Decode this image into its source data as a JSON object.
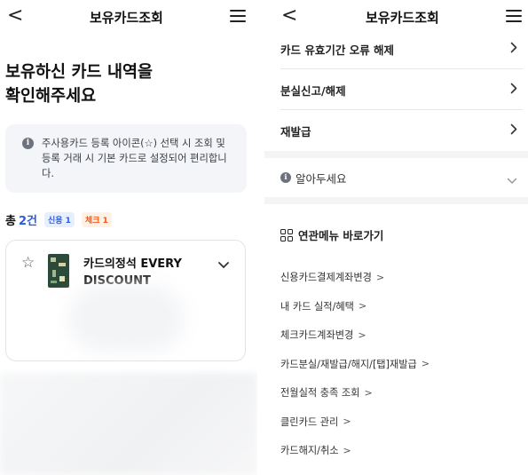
{
  "left": {
    "header": {
      "back": "<",
      "title": "보유카드조회"
    },
    "heading_line1": "보유하신 카드 내역을",
    "heading_line2": "확인해주세요",
    "notice": {
      "icon": "i",
      "text": "주사용카드 등록 아이콘(☆) 선택 시 조회 및 등록 거래 시 기본 카드로 설정되어 편리합니다."
    },
    "summary": {
      "total_label": "총",
      "total_count": "2건",
      "badge_credit": "신용 1",
      "badge_check": "체크 1"
    },
    "card": {
      "star": "☆",
      "name": "카드의정석 EVERY DISCOUNT"
    }
  },
  "right": {
    "header": {
      "back": "<",
      "title": "보유카드조회"
    },
    "rows": [
      {
        "label": "카드 유효기간 오류 해제",
        "arrow": ">"
      },
      {
        "label": "분실신고/해제",
        "arrow": ">"
      },
      {
        "label": "재발급",
        "arrow": ">"
      }
    ],
    "know": {
      "icon": "i",
      "label": "알아두세요"
    },
    "related": {
      "title": "연관메뉴 바로가기",
      "links": [
        {
          "label": "신용카드결제계좌변경",
          "arrow": ">"
        },
        {
          "label": "내 카드 실적/혜택",
          "arrow": ">"
        },
        {
          "label": "체크카드계좌변경",
          "arrow": ">"
        },
        {
          "label": "카드분실/재발급/해지/[탭]재발급",
          "arrow": ">"
        },
        {
          "label": "전월실적 충족 조회",
          "arrow": ">"
        },
        {
          "label": "클린카드 관리",
          "arrow": ">"
        },
        {
          "label": "카드해지/취소",
          "arrow": ">"
        }
      ]
    }
  },
  "colors": {
    "accent_blue": "#2b5ce0",
    "badge_orange": "#f05a1a",
    "notice_bg": "#f3f5f8"
  },
  "icons": [
    "back-icon",
    "menu-icon",
    "info-icon",
    "star-icon",
    "chevron-down-icon",
    "chevron-right-icon",
    "grid-icon"
  ]
}
